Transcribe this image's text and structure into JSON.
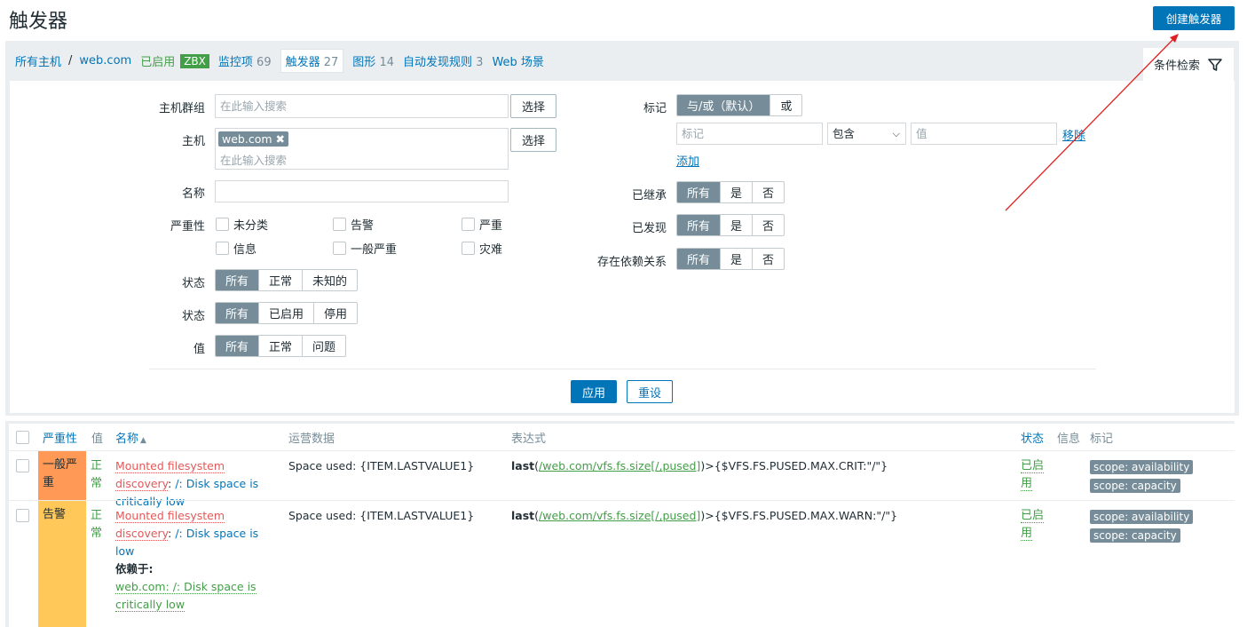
{
  "header": {
    "title": "触发器",
    "create_button": "创建触发器"
  },
  "nav": {
    "all_hosts": "所有主机",
    "separator": "/",
    "host": "web.com",
    "enabled": "已启用",
    "zbx": "ZBX",
    "items_label": "监控项",
    "items_count": "69",
    "triggers_label": "触发器",
    "triggers_count": "27",
    "graphs_label": "图形",
    "graphs_count": "14",
    "discovery_label": "自动发现规则",
    "discovery_count": "3",
    "web_label": "Web 场景",
    "filter_tab": "条件检索"
  },
  "filter": {
    "host_group_label": "主机群组",
    "host_group_placeholder": "在此输入搜索",
    "select_button": "选择",
    "host_label": "主机",
    "host_chip": "web.com",
    "host_placeholder": "在此输入搜索",
    "name_label": "名称",
    "severity_label": "严重性",
    "severities": [
      "未分类",
      "告警",
      "严重",
      "信息",
      "一般严重",
      "灾难"
    ],
    "state_label": "状态",
    "state_options": [
      "所有",
      "正常",
      "未知的"
    ],
    "status_label": "状态",
    "status_options": [
      "所有",
      "已启用",
      "停用"
    ],
    "value_label": "值",
    "value_options": [
      "所有",
      "正常",
      "问题"
    ],
    "tags_label": "标记",
    "tags_ops": [
      "与/或（默认）",
      "或"
    ],
    "tag_placeholder": "标记",
    "tag_operator": "包含",
    "tag_value_placeholder": "值",
    "remove_link": "移除",
    "add_link": "添加",
    "inherited_label": "已继承",
    "discovered_label": "已发现",
    "dependencies_label": "存在依赖关系",
    "tri_options": [
      "所有",
      "是",
      "否"
    ],
    "apply_button": "应用",
    "reset_button": "重设"
  },
  "table": {
    "headers": {
      "severity": "严重性",
      "value": "值",
      "name": "名称",
      "sort_arrow": "▲",
      "opdata": "运营数据",
      "expression": "表达式",
      "status": "状态",
      "info": "信息",
      "tags": "标记"
    },
    "rows": [
      {
        "severity": "一般严重",
        "severity_color": "#ff9955",
        "value": "正常",
        "name_prefix": "Mounted filesystem discovery",
        "name_suffix": "/: Disk space is critically low",
        "opdata": "Space used: {ITEM.LASTVALUE1}",
        "expr_func": "last",
        "expr_item": "/web.com/vfs.fs.size[/,pused]",
        "expr_rest": ">{$VFS.FS.PUSED.MAX.CRIT:\"/\"}",
        "status": "已启用",
        "tags": [
          "scope: availability",
          "scope: capacity"
        ]
      },
      {
        "severity": "告警",
        "severity_color": "#ffc859",
        "value": "正常",
        "name_prefix": "Mounted filesystem discovery",
        "name_suffix": "/: Disk space is low",
        "depends_label": "依赖于:",
        "depends_on": "web.com: /: Disk space is critically low",
        "opdata": "Space used: {ITEM.LASTVALUE1}",
        "expr_func": "last",
        "expr_item": "/web.com/vfs.fs.size[/,pused]",
        "expr_rest": ">{$VFS.FS.PUSED.MAX.WARN:\"/\"}",
        "status": "已启用",
        "tags": [
          "scope: availability",
          "scope: capacity"
        ]
      }
    ]
  },
  "colors": {
    "brand_blue": "#0275b8",
    "green": "#429e47",
    "red": "#e45959",
    "segment_active": "#768d99"
  }
}
